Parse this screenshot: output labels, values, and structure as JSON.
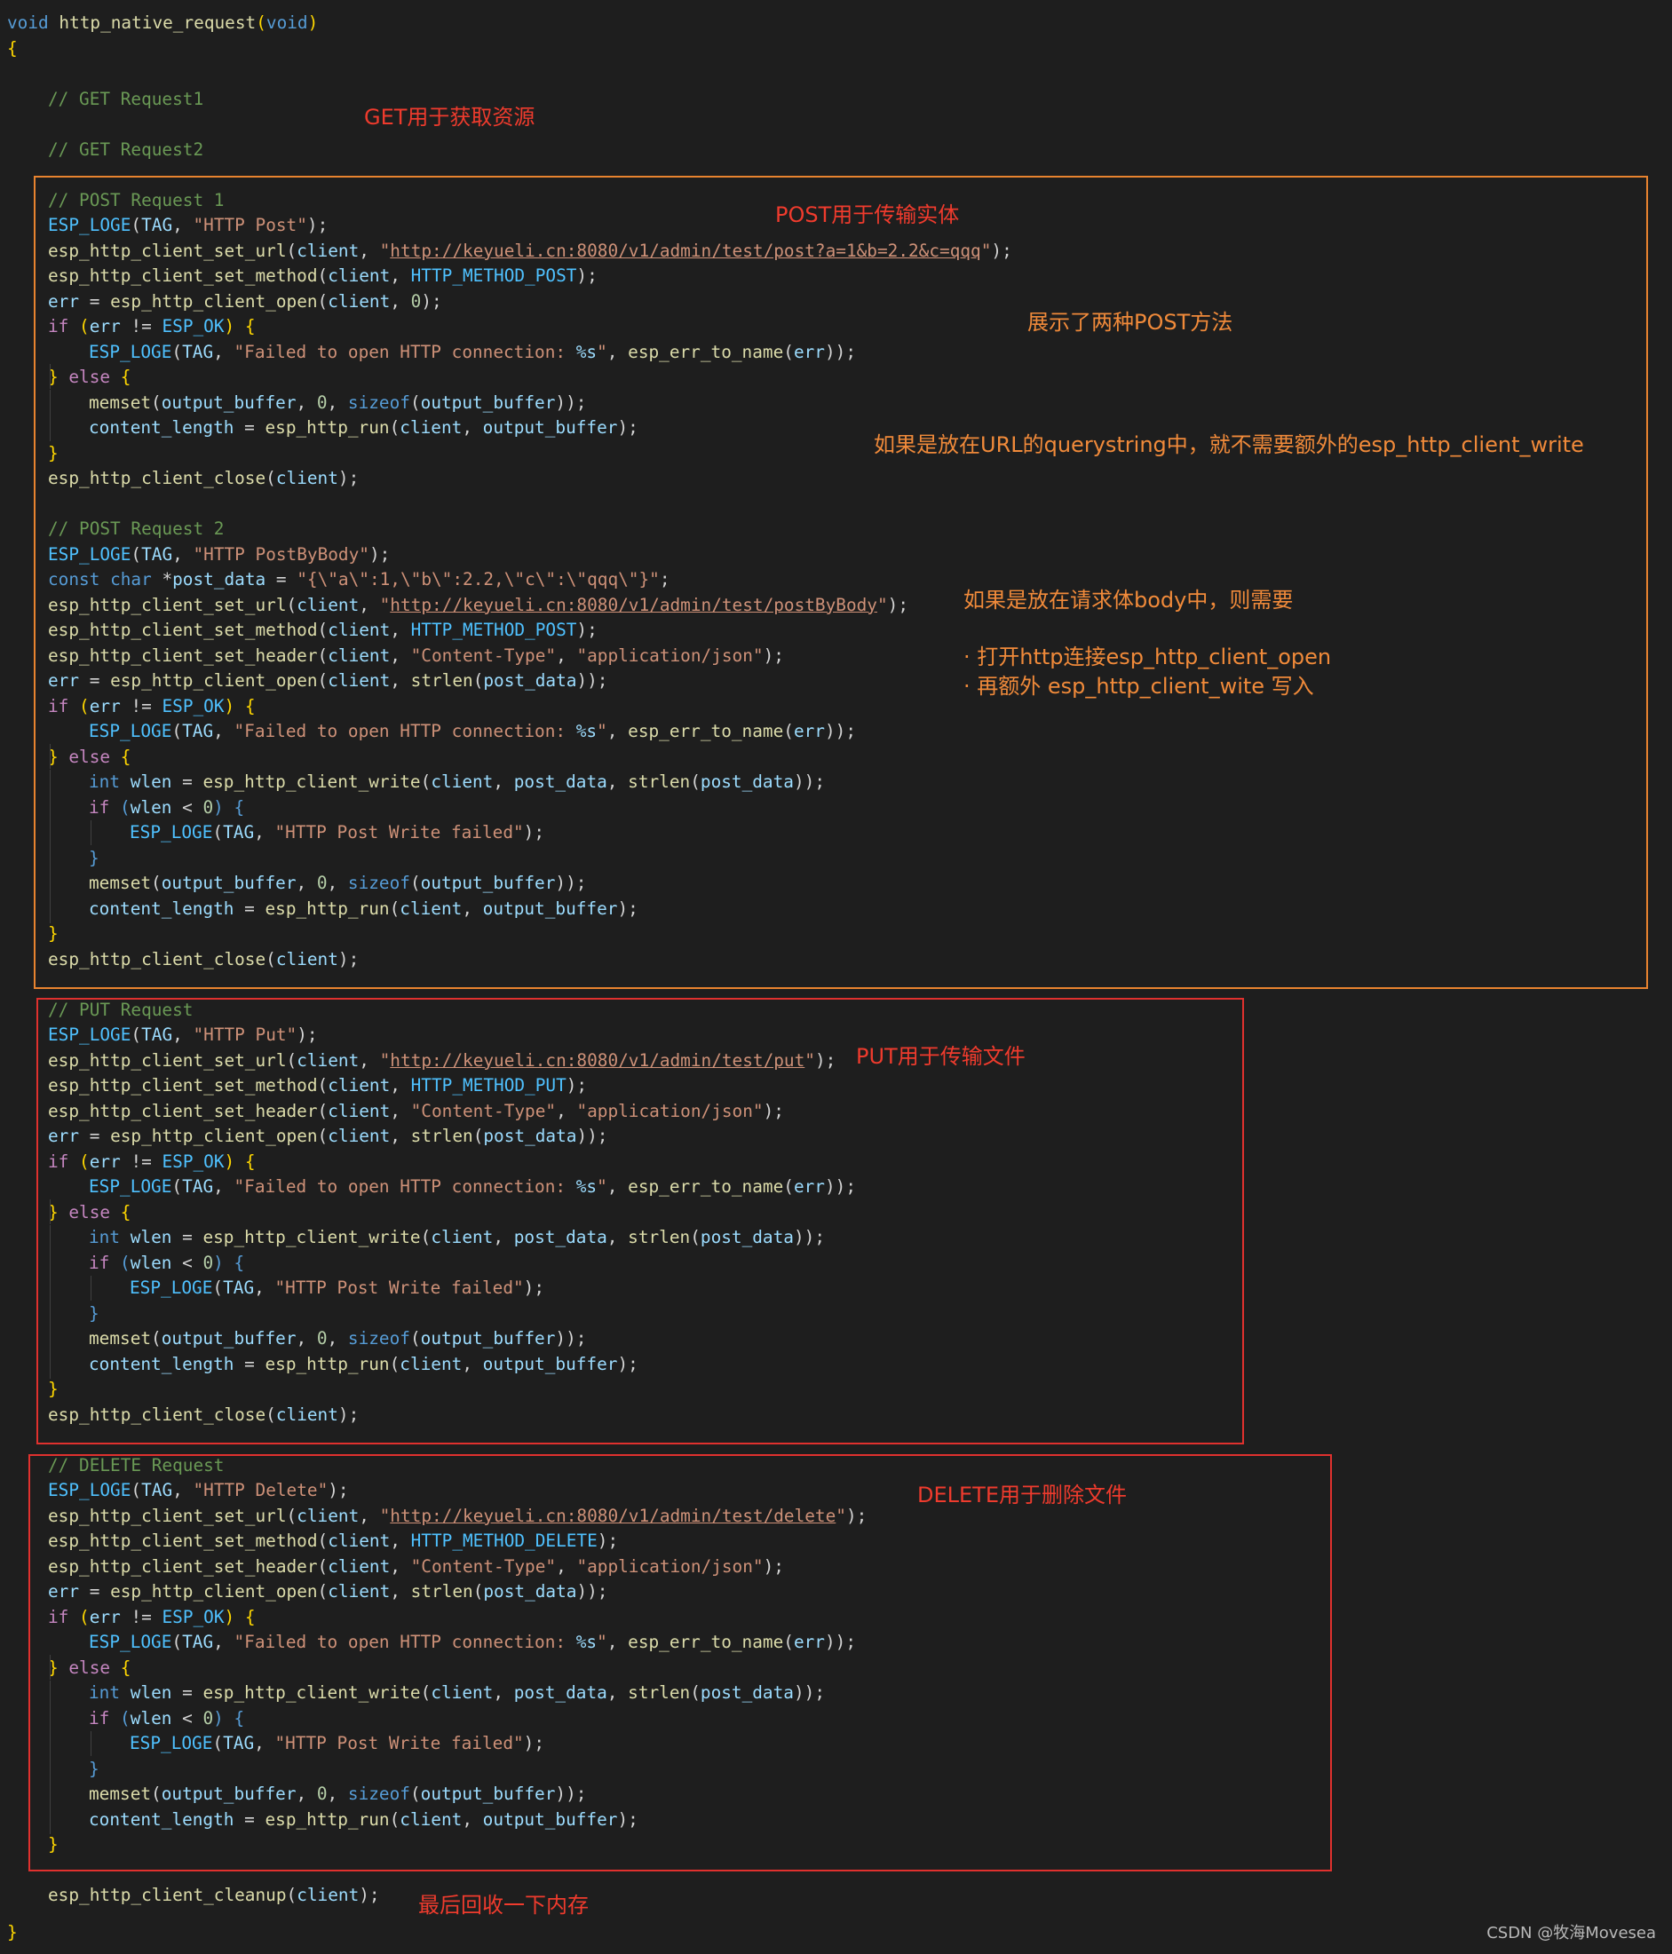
{
  "code": {
    "signature": {
      "void1": "void",
      "name": "http_native_request",
      "void2": "void"
    },
    "open_brace": "{",
    "close_brace": "}",
    "get1_comment": "// GET Request1",
    "get2_comment": "// GET Request2",
    "post1_comment": "// POST Request 1",
    "post2_comment": "// POST Request 2",
    "put_comment": "// PUT Request",
    "delete_comment": "// DELETE Request",
    "cleanup": "esp_http_client_cleanup",
    "urls": {
      "post": "http://keyueli.cn:8080/v1/admin/test/post?a=1&b=2.2&c=qqq",
      "post_by_body": "http://keyueli.cn:8080/v1/admin/test/postByBody",
      "put": "http://keyueli.cn:8080/v1/admin/test/put",
      "delete": "http://keyueli.cn:8080/v1/admin/test/delete"
    },
    "tags": {
      "post": "\"HTTP Post\"",
      "post_by_body": "\"HTTP PostByBody\"",
      "put": "\"HTTP Put\"",
      "delete": "\"HTTP Delete\""
    },
    "methods": {
      "post": "HTTP_METHOD_POST",
      "put": "HTTP_METHOD_PUT",
      "delete": "HTTP_METHOD_DELETE"
    },
    "post_data_literal": "\"{\\\"a\\\":1,\\\"b\\\":2.2,\\\"c\\\":\\\"qqq\\\"}\"",
    "content_type_key": "\"Content-Type\"",
    "content_type_val": "\"application/json\"",
    "fail_open_msg": "\"Failed to open HTTP connection: ",
    "fail_open_fmt": "%s",
    "write_fail_msg": "\"HTTP Post Write failed\""
  },
  "annotations": {
    "get": "GET用于获取资源",
    "post": "POST用于传输实体",
    "two_post": "展示了两种POST方法",
    "querystring": "如果是放在URL的querystring中，就不需要额外的esp_http_client_write",
    "body": "如果是放在请求体body中，则需要",
    "bullet1": "· 打开http连接esp_http_client_open",
    "bullet2": "· 再额外 esp_http_client_wite 写入",
    "put": "PUT用于传输文件",
    "delete": "DELETE用于删除文件",
    "cleanup": "最后回收一下内存"
  },
  "watermark": "CSDN @牧海Movesea",
  "colors": {
    "background": "#1e1e1e",
    "orange_box": "#e8832f",
    "red_box": "#e0312e",
    "red_text": "#ef3b2d",
    "orange_text": "#f08a3a"
  }
}
